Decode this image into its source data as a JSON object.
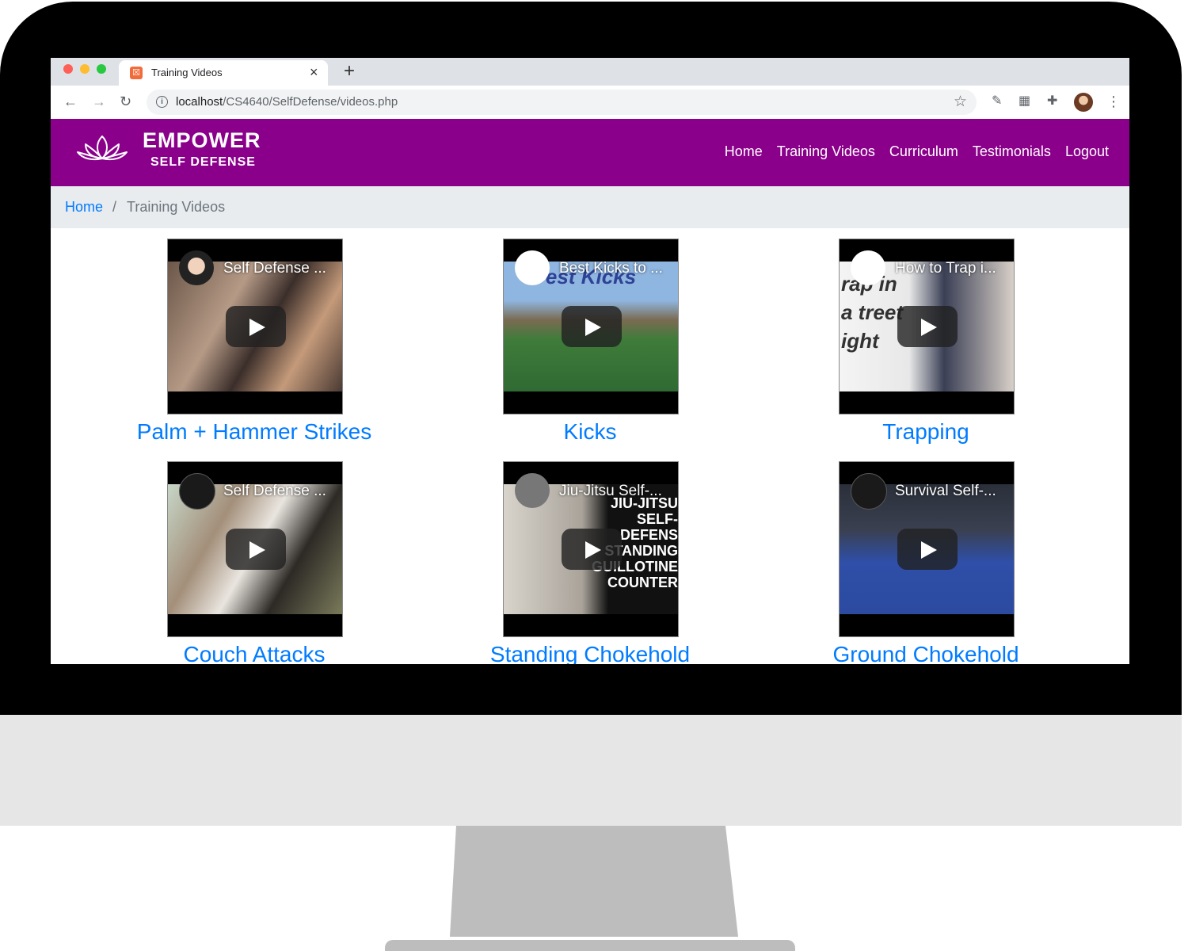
{
  "browser": {
    "tab_title": "Training Videos",
    "tab_close": "×",
    "new_tab": "+",
    "url_host": "localhost",
    "url_path": "/CS4640/SelfDefense/videos.php",
    "nav_back": "←",
    "nav_forward": "→",
    "nav_reload": "↻",
    "bookmark_icon": "☆",
    "extension_icons": [
      "pen-icon",
      "grid-icon",
      "puzzle-icon"
    ],
    "menu_icon": "⋮"
  },
  "site": {
    "brand_name": "EMPOWER",
    "brand_tagline": "SELF DEFENSE",
    "accent_color": "#8b008b",
    "link_color": "#007bff",
    "nav": [
      "Home",
      "Training Videos",
      "Curriculum",
      "Testimonials",
      "Logout"
    ]
  },
  "breadcrumb": {
    "home": "Home",
    "separator": "/",
    "current": "Training Videos"
  },
  "videos": [
    {
      "caption": "Palm + Hammer Strikes",
      "title": "Self Defense ...",
      "thumb_text": ""
    },
    {
      "caption": "Kicks",
      "title": "Best Kicks to ...",
      "thumb_text": "est Kicks"
    },
    {
      "caption": "Trapping",
      "title": "How to Trap i...",
      "thumb_text": "rap in a treet ight"
    },
    {
      "caption": "Couch Attacks",
      "title": "Self Defense ...",
      "thumb_text": ""
    },
    {
      "caption": "Standing Chokehold",
      "title": "Jiu-Jitsu Self-...",
      "thumb_text": "JIU-JITSU SELF-DEFENS STANDING GUILLOTINE COUNTER"
    },
    {
      "caption": "Ground Chokehold",
      "title": "Survival Self-...",
      "thumb_text": ""
    }
  ]
}
